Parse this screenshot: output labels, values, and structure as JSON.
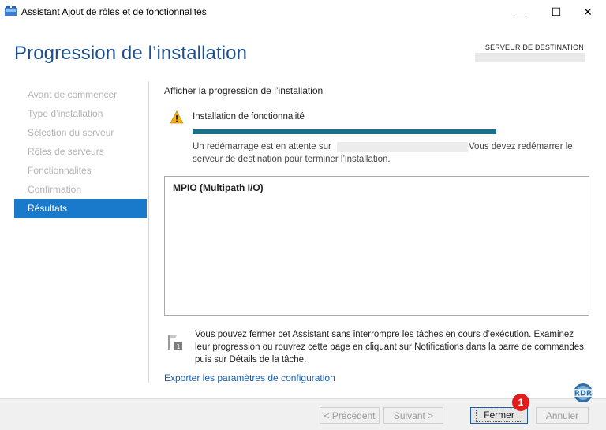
{
  "window": {
    "title": "Assistant Ajout de rôles et de fonctionnalités",
    "minimize_glyph": "—",
    "maximize_glyph": "☐",
    "close_glyph": "✕"
  },
  "header": {
    "title": "Progression de l’installation",
    "destination_label": "SERVEUR DE DESTINATION"
  },
  "sidebar": {
    "items": [
      {
        "label": "Avant de commencer",
        "active": false
      },
      {
        "label": "Type d’installation",
        "active": false
      },
      {
        "label": "Sélection du serveur",
        "active": false
      },
      {
        "label": "Rôles de serveurs",
        "active": false
      },
      {
        "label": "Fonctionnalités",
        "active": false
      },
      {
        "label": "Confirmation",
        "active": false
      },
      {
        "label": "Résultats",
        "active": true
      }
    ]
  },
  "main": {
    "heading": "Afficher la progression de l’installation",
    "status_title": "Installation de fonctionnalité",
    "progress_percent": 100,
    "message_start": "Un redémarrage est en attente sur",
    "message_end": "Vous devez redémarrer le",
    "message_line2": "serveur de destination pour terminer l’installation.",
    "feature": "MPIO (Multipath I/O)",
    "info": "Vous pouvez fermer cet Assistant sans interrompre les tâches en cours d’exécution. Examinez leur progression ou rouvrez cette page en cliquant sur Notifications dans la barre de commandes, puis sur Détails de la tâche.",
    "export_link": "Exporter les paramètres de configuration"
  },
  "footer": {
    "previous": "< Précédent",
    "next": "Suivant >",
    "close": "Fermer",
    "cancel": "Annuler",
    "step_badge": "1",
    "logo_text": "RDR"
  },
  "colors": {
    "accent": "#1979ca",
    "title": "#1f4f8a",
    "progress": "#1b6f88",
    "badge": "#e01d1d"
  },
  "icons": [
    "server-manager-icon",
    "warning-icon",
    "info-flag-icon",
    "rdr-logo-icon"
  ]
}
